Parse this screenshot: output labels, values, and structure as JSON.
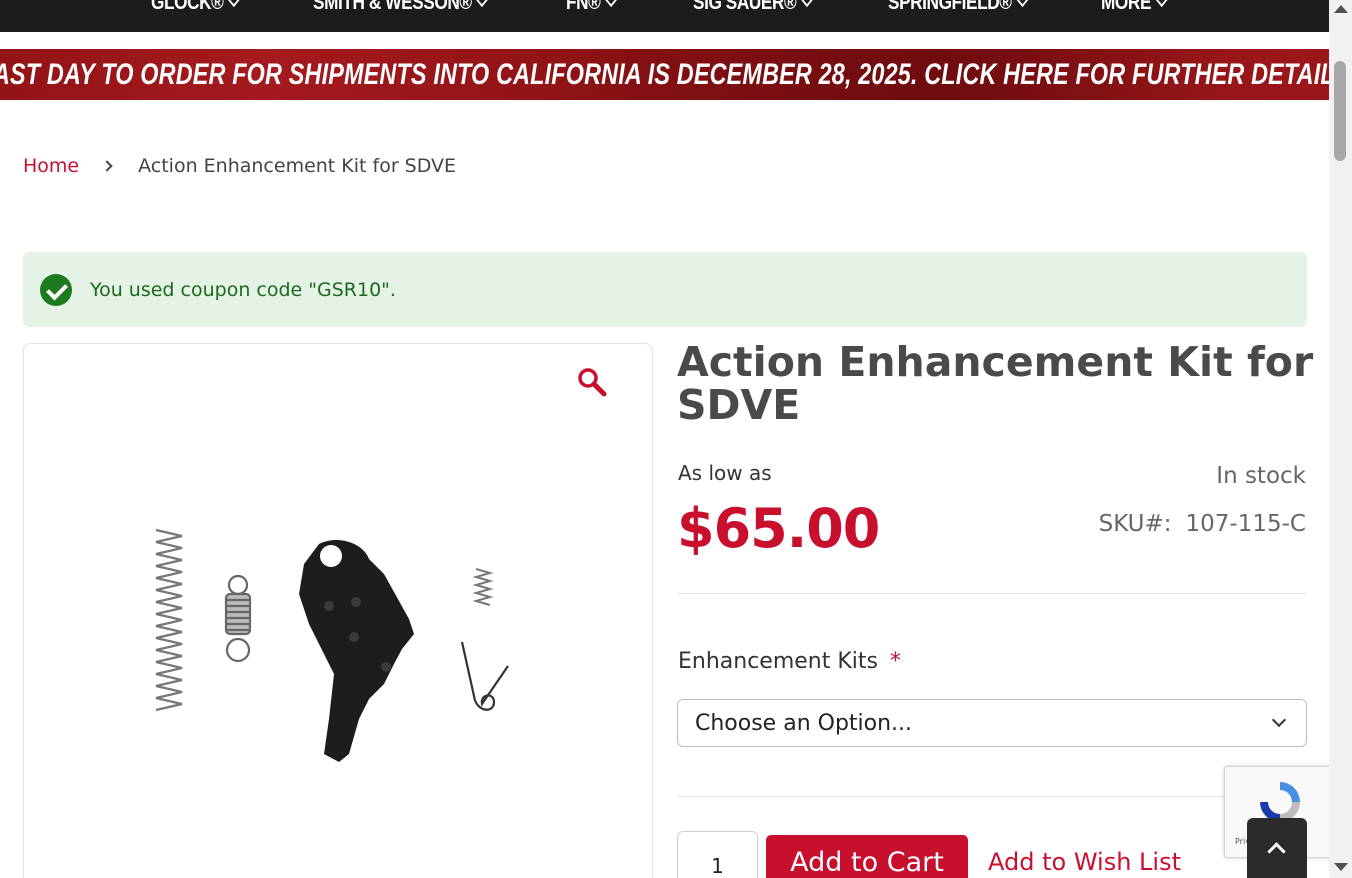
{
  "nav": {
    "items": [
      {
        "label": "GLOCK®"
      },
      {
        "label": "SMITH & WESSON®"
      },
      {
        "label": "FN®"
      },
      {
        "label": "SIG SAUER®"
      },
      {
        "label": "SPRINGFIELD®"
      },
      {
        "label": "MORE"
      }
    ]
  },
  "promo": {
    "text": "LAST DAY TO ORDER FOR SHIPMENTS INTO CALIFORNIA IS DECEMBER 28, 2025. CLICK HERE FOR FURTHER DETAILS"
  },
  "breadcrumb": {
    "home": "Home",
    "current": "Action Enhancement Kit for SDVE"
  },
  "message": {
    "text": "You used coupon code \"GSR10\"."
  },
  "product": {
    "title": "Action Enhancement Kit for SDVE",
    "price_prefix": "As low as",
    "price": "$65.00",
    "stock": "In stock",
    "sku_label": "SKU#:",
    "sku": "107-115-C",
    "option_label": "Enhancement Kits",
    "option_required": "*",
    "option_selected": "Choose an Option...",
    "quantity": "1",
    "add_to_cart": "Add to Cart",
    "wishlist": "Add to Wish List"
  },
  "recaptcha": {
    "text": "Privacy - Terms"
  },
  "colors": {
    "brand_red": "#c8102e",
    "nav_bg": "#1c1c1c",
    "success_bg": "#e5f2e6",
    "success_text": "#1b6a1c"
  }
}
